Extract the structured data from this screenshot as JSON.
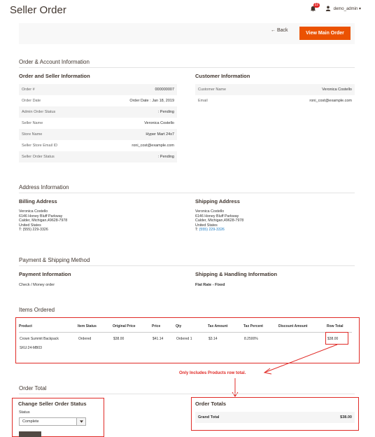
{
  "header": {
    "title": "Seller Order",
    "notification_count": "22",
    "user": "demo_admin ▾"
  },
  "actions": {
    "back_label": "← Back",
    "main_order_label": "View Main Order"
  },
  "order_account": {
    "section_title": "Order & Account Information",
    "order_seller": {
      "title": "Order and Seller Information",
      "rows": [
        {
          "label": "Order #",
          "value": "000000007"
        },
        {
          "label": "Order Date",
          "value": "Order Date : Jan 18, 2019"
        },
        {
          "label": "Admin Order Status",
          "value": ": Pending"
        },
        {
          "label": "Seller Name",
          "value": "Veronica Costello"
        },
        {
          "label": "Store Name",
          "value": "Hyper Mart 24x7"
        },
        {
          "label": "Seller Store Email ID",
          "value": "roni_cost@example.com"
        },
        {
          "label": "Seller Order Status",
          "value": ": Pending"
        }
      ]
    },
    "customer": {
      "title": "Customer Information",
      "rows": [
        {
          "label": "Customer Name",
          "value": "Veronica Costello"
        },
        {
          "label": "Email",
          "value": "roni_cost@example.com"
        }
      ]
    }
  },
  "address": {
    "section_title": "Address Information",
    "billing": {
      "title": "Billing Address",
      "name": "Veronica Costello",
      "street": "6146 Honey Bluff Parkway",
      "city": "Calder, Michigan,49628-7978",
      "country": "United States",
      "phone": "T: (555) 229-3326"
    },
    "shipping": {
      "title": "Shipping Address",
      "name": "Veronica Costello",
      "street": "6146 Honey Bluff Parkway",
      "city": "Calder, Michigan,49628-7978",
      "country": "United States",
      "phone_prefix": "T:",
      "phone": "(555) 229-3326"
    }
  },
  "payment_shipping": {
    "section_title": "Payment & Shipping Method",
    "payment": {
      "title": "Payment Information",
      "value": "Check / Money order"
    },
    "shipping": {
      "title": "Shipping & Handling Information",
      "value": "Flat Rate - Fixed"
    }
  },
  "items": {
    "section_title": "Items Ordered",
    "headers": [
      "Product",
      "Item Status",
      "Original Price",
      "Price",
      "Qty",
      "Tax Amount",
      "Tax Percent",
      "Discount Amount",
      "Row Total"
    ],
    "rows": [
      {
        "product": "Crown Summit Backpack",
        "sku": "SKU:24-MB03",
        "status": "Ordered",
        "original_price": "$38.00",
        "price": "$41.14",
        "qty": "Ordered 1",
        "tax_amount": "$3.14",
        "tax_percent": "8.2500%",
        "discount": "",
        "row_total": "$38.00"
      }
    ]
  },
  "annotation": {
    "text": "Only Includes Products row total."
  },
  "order_total": {
    "section_title": "Order Total",
    "change_status": {
      "title": "Change Seller Order Status",
      "status_label": "Status",
      "selected": "Complete"
    },
    "totals": {
      "title": "Order Totals",
      "grand_total_label": "Grand Total",
      "grand_total_value": "$38.00"
    }
  }
}
